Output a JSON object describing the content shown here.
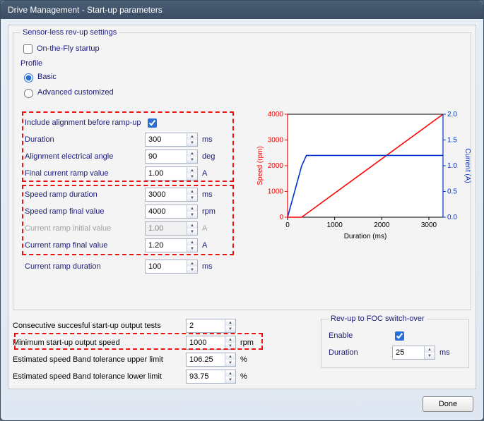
{
  "window": {
    "title": "Drive Management - Start-up parameters"
  },
  "main": {
    "legend": "Sensor-less rev-up settings",
    "onTheFly": {
      "label": "On-the-Fly startup",
      "checked": false
    },
    "profile": {
      "label": "Profile",
      "basic": {
        "label": "Basic",
        "selected": true
      },
      "advanced": {
        "label": "Advanced customized",
        "selected": false
      }
    },
    "align": {
      "include": {
        "label": "Include alignment before ramp-up",
        "checked": true
      },
      "duration": {
        "label": "Duration",
        "value": "300",
        "unit": "ms"
      },
      "angle": {
        "label": "Alignment electrical angle",
        "value": "90",
        "unit": "deg"
      },
      "finalCurrent": {
        "label": "Final current ramp value",
        "value": "1.00",
        "unit": "A"
      }
    },
    "ramp": {
      "speedDur": {
        "label": "Speed ramp duration",
        "value": "3000",
        "unit": "ms"
      },
      "speedFinal": {
        "label": "Speed ramp final value",
        "value": "4000",
        "unit": "rpm"
      },
      "curInit": {
        "label": "Current ramp initial value",
        "value": "1.00",
        "unit": "A"
      },
      "curFinal": {
        "label": "Current ramp final value",
        "value": "1.20",
        "unit": "A"
      }
    },
    "curRampDur": {
      "label": "Current ramp duration",
      "value": "100",
      "unit": "ms"
    }
  },
  "bottom": {
    "consec": {
      "label": "Consecutive succesful start-up output tests",
      "value": "2",
      "unit": ""
    },
    "minSpeed": {
      "label": "Minimum start-up output speed",
      "value": "1000",
      "unit": "rpm"
    },
    "bandUpper": {
      "label": "Estimated speed Band tolerance upper limit",
      "value": "106.25",
      "unit": "%"
    },
    "bandLower": {
      "label": "Estimated speed Band tolerance lower limit",
      "value": "93.75",
      "unit": "%"
    }
  },
  "rev": {
    "legend": "Rev-up to FOC switch-over",
    "enable": {
      "label": "Enable",
      "checked": true
    },
    "duration": {
      "label": "Duration",
      "value": "25",
      "unit": "ms"
    }
  },
  "done": "Done",
  "chart_data": {
    "type": "line",
    "xlabel": "Duration (ms)",
    "ylabel_left": "Speed (rpm)",
    "ylabel_right": "Current (A)",
    "xlim": [
      0,
      3300
    ],
    "ylim_left": [
      0,
      4000
    ],
    "ylim_right": [
      0,
      2.0
    ],
    "x_ticks": [
      0,
      1000,
      2000,
      3000
    ],
    "y_ticks_left": [
      0,
      1000,
      2000,
      3000,
      4000
    ],
    "y_ticks_right": [
      0,
      0.5,
      1.0,
      1.5,
      2.0
    ],
    "series": [
      {
        "name": "Speed",
        "color": "#ff0000",
        "axis": "left",
        "x": [
          0,
          300,
          3300
        ],
        "y": [
          0,
          0,
          4000
        ]
      },
      {
        "name": "Current",
        "color": "#0033cc",
        "axis": "right",
        "x": [
          0,
          300,
          400,
          3300
        ],
        "y": [
          0,
          1.0,
          1.2,
          1.2
        ]
      }
    ]
  }
}
